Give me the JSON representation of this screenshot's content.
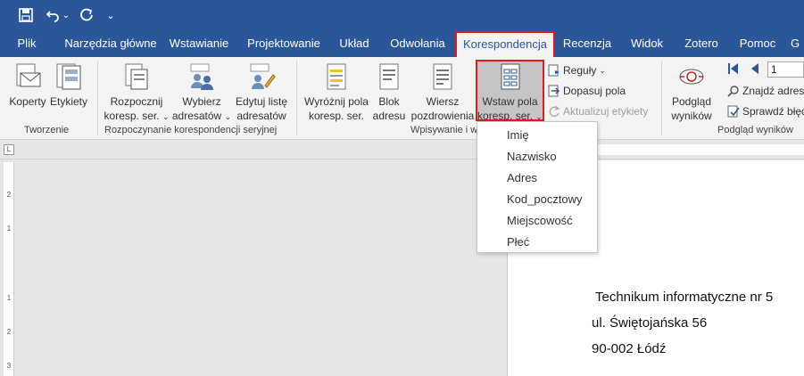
{
  "quick_access": {
    "undo_caret": "⌄",
    "customize": "⌄"
  },
  "tabs": [
    {
      "label": "Plik"
    },
    {
      "label": "Narzędzia główne"
    },
    {
      "label": "Wstawianie"
    },
    {
      "label": "Projektowanie"
    },
    {
      "label": "Układ"
    },
    {
      "label": "Odwołania"
    },
    {
      "label": "Korespondencja"
    },
    {
      "label": "Recenzja"
    },
    {
      "label": "Widok"
    },
    {
      "label": "Zotero"
    },
    {
      "label": "Pomoc"
    },
    {
      "label": "G"
    }
  ],
  "ribbon": {
    "tworzenie": {
      "label": "Tworzenie",
      "koperty": "Koperty",
      "etykiety": "Etykiety"
    },
    "rozpoczynanie": {
      "label": "Rozpoczynanie korespondencji seryjnej",
      "rozpocznij_1": "Rozpocznij",
      "rozpocznij_2": "koresp. ser.",
      "wybierz_1": "Wybierz",
      "wybierz_2": "adresatów",
      "edytuj_1": "Edytuj listę",
      "edytuj_2": "adresatów",
      "caret": "⌄"
    },
    "wpisywanie": {
      "label": "Wpisywanie i w",
      "wyroznij_1": "Wyróżnij pola",
      "wyroznij_2": "koresp. ser.",
      "blok_1": "Blok",
      "blok_2": "adresu",
      "wiersz_1": "Wiersz",
      "wiersz_2": "pozdrowienia",
      "wstaw_1": "Wstaw pola",
      "wstaw_2": "koresp. ser.",
      "reguly": "Reguły",
      "dopasuj": "Dopasuj pola",
      "aktualizuj": "Aktualizuj etykiety"
    },
    "podglad": {
      "label": "Podgląd wyników",
      "podglad_1": "Podgląd",
      "podglad_2": "wyników",
      "record_number": "1",
      "znajdz": "Znajdź adresa",
      "sprawdz": "Sprawdź błęd"
    }
  },
  "dropdown": {
    "items": [
      "Imię",
      "Nazwisko",
      "Adres",
      "Kod_pocztowy",
      "Miejscowość",
      "Płeć"
    ]
  },
  "ruler": {
    "corner": "L",
    "marks": [
      "2",
      "1",
      "1",
      "2",
      "3"
    ]
  },
  "document": {
    "line1": "Technikum informatyczne nr 5",
    "line2": "ul. Świętojańska 56",
    "line3": "90-002 Łódź"
  },
  "colors": {
    "titlebar": "#2b579a",
    "highlight_border": "#e01b1b",
    "ribbon_bg": "#f3f3f3"
  }
}
